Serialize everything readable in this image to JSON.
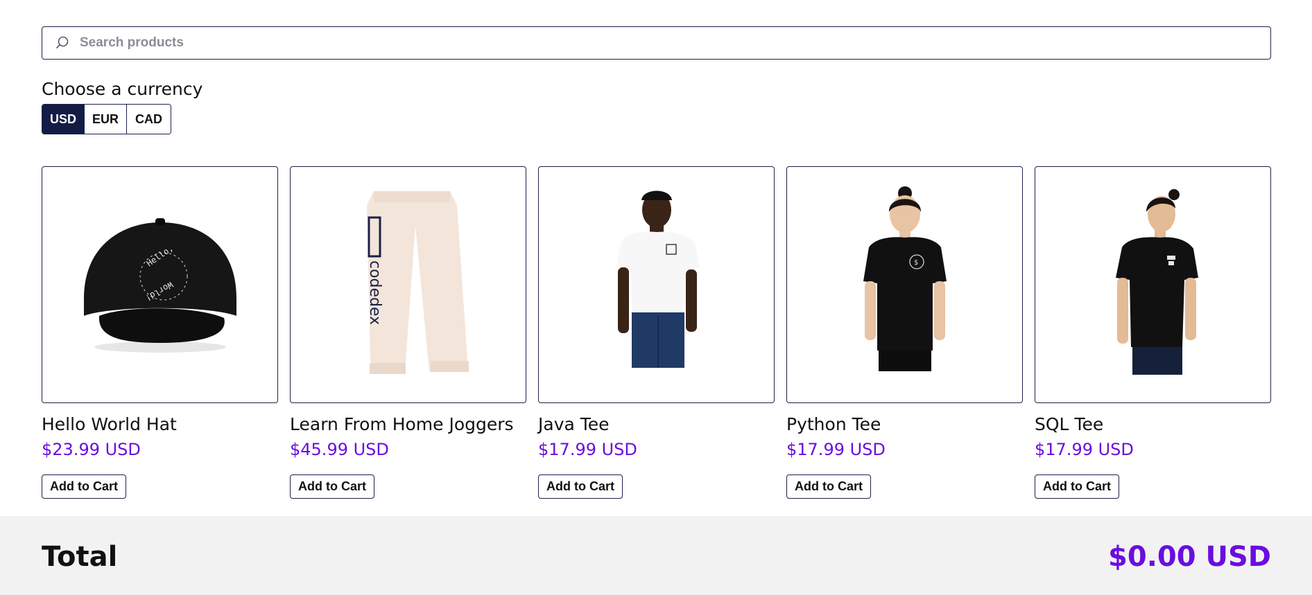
{
  "search": {
    "placeholder": "Search products",
    "value": ""
  },
  "currency": {
    "heading": "Choose a currency",
    "options": [
      "USD",
      "EUR",
      "CAD"
    ],
    "selected": "USD"
  },
  "products": [
    {
      "name": "Hello World Hat",
      "price": "$23.99 USD",
      "button": "Add to Cart",
      "image": "black-cap-image"
    },
    {
      "name": "Learn From Home Joggers",
      "price": "$45.99 USD",
      "button": "Add to Cart",
      "image": "cream-joggers-image"
    },
    {
      "name": "Java Tee",
      "price": "$17.99 USD",
      "button": "Add to Cart",
      "image": "white-tee-image"
    },
    {
      "name": "Python Tee",
      "price": "$17.99 USD",
      "button": "Add to Cart",
      "image": "black-tee-woman-image"
    },
    {
      "name": "SQL Tee",
      "price": "$17.99 USD",
      "button": "Add to Cart",
      "image": "black-tee-man-image"
    }
  ],
  "footer": {
    "total_label": "Total",
    "total_value": "$0.00 USD"
  },
  "colors": {
    "primary": "#141b45",
    "accent": "#6a0ddf",
    "footer_bg": "#f2f2f2"
  }
}
